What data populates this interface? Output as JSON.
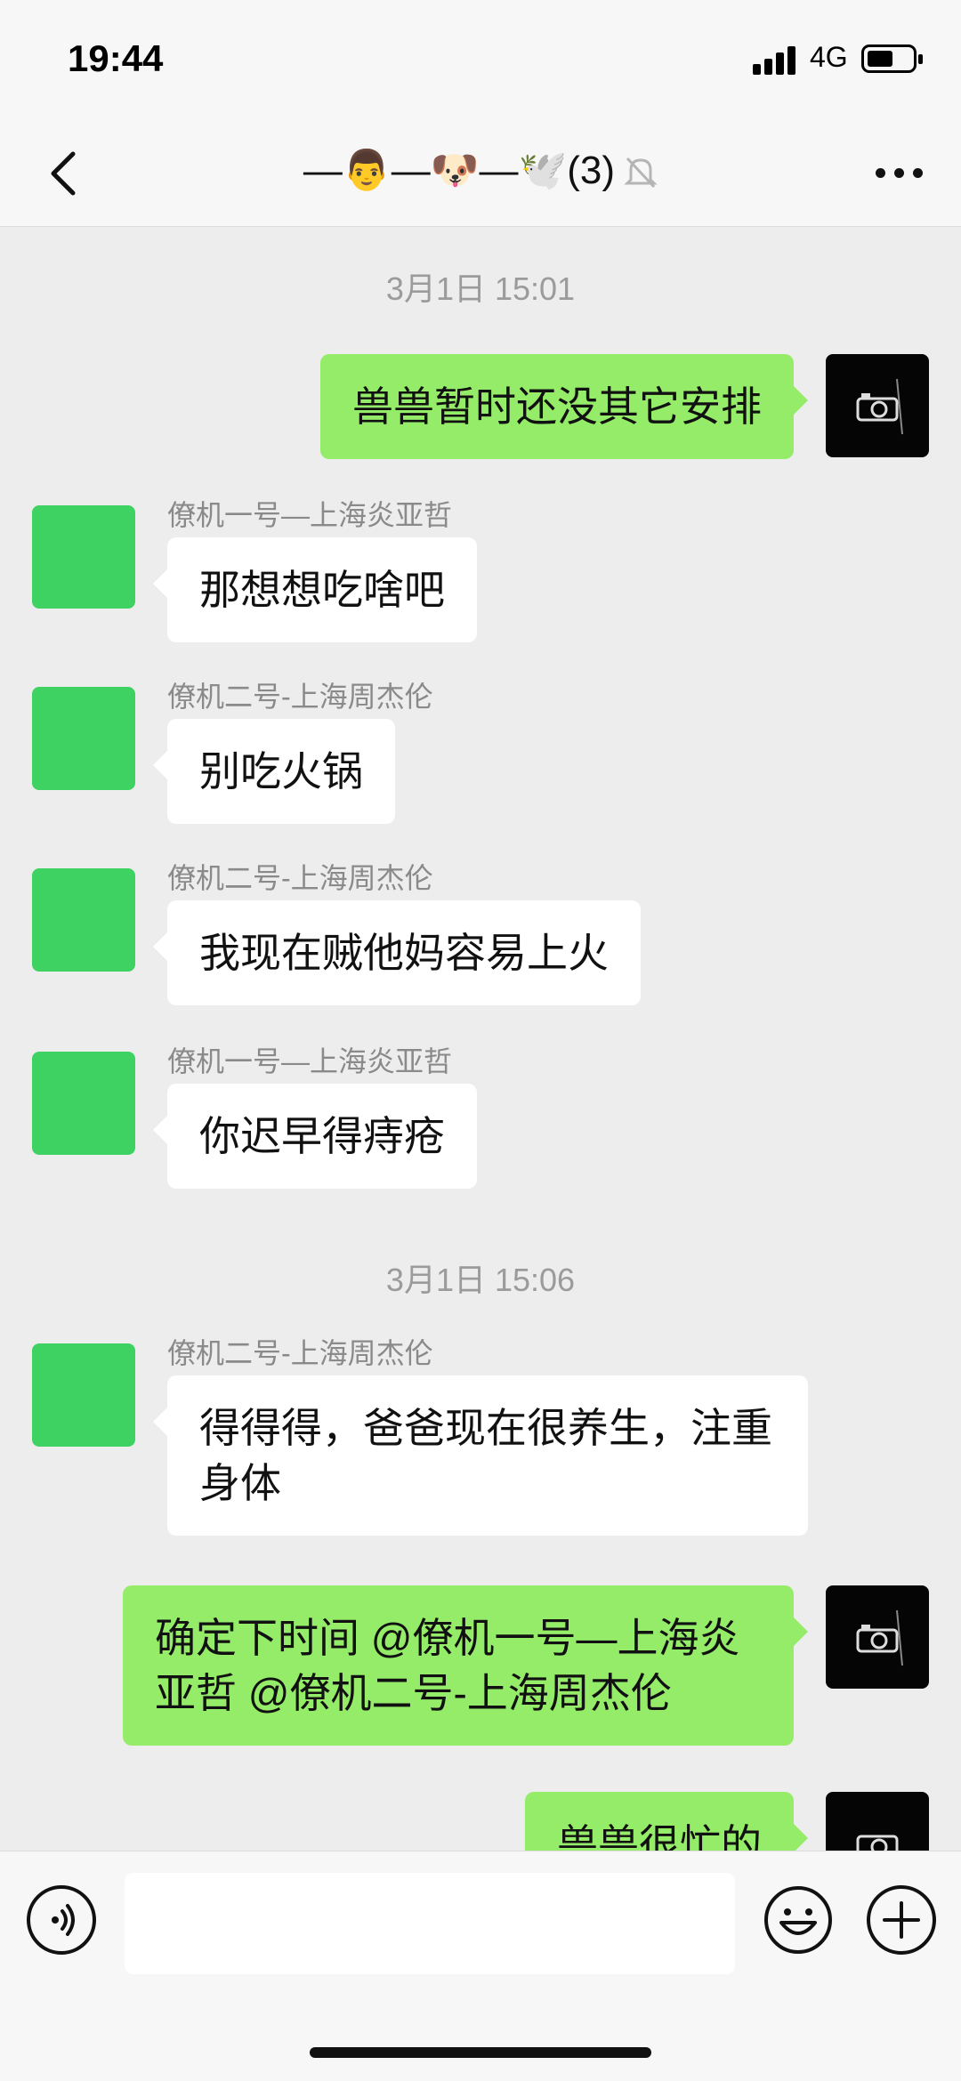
{
  "status_bar": {
    "time": "19:44",
    "network": "4G"
  },
  "header": {
    "title": "—👨—🐶—🕊️",
    "member_count": "(3)",
    "muted": true,
    "icons": [
      "back-chevron-icon",
      "bell-muted-icon",
      "more-dots-icon"
    ]
  },
  "messages": [
    {
      "type": "timestamp",
      "text": "3月1日 15:01"
    },
    {
      "type": "msg",
      "side": "right",
      "text": "兽兽暂时还没其它安排"
    },
    {
      "type": "msg",
      "side": "left",
      "sender": "僚机一号—上海炎亚哲",
      "text": "那想想吃啥吧"
    },
    {
      "type": "msg",
      "side": "left",
      "sender": "僚机二号-上海周杰伦",
      "text": "别吃火锅"
    },
    {
      "type": "msg",
      "side": "left",
      "sender": "僚机二号-上海周杰伦",
      "text": "我现在贼他妈容易上火"
    },
    {
      "type": "msg",
      "side": "left",
      "sender": "僚机一号—上海炎亚哲",
      "text": "你迟早得痔疮"
    },
    {
      "type": "timestamp",
      "text": "3月1日 15:06"
    },
    {
      "type": "msg",
      "side": "left",
      "sender": "僚机二号-上海周杰伦",
      "text": "得得得，爸爸现在很养生，注重身体"
    },
    {
      "type": "msg",
      "side": "right",
      "text": "确定下时间 @僚机一号—上海炎亚哲 @僚机二号-上海周杰伦"
    },
    {
      "type": "msg",
      "side": "right",
      "text": "兽兽很忙的"
    }
  ],
  "input_bar": {
    "value": "",
    "icons": [
      "voice-icon",
      "emoji-icon",
      "plus-icon"
    ]
  },
  "colors": {
    "self_bubble": "#95ec69",
    "other_bubble": "#ffffff",
    "background": "#ededed",
    "avatar_green": "#3ed262"
  }
}
